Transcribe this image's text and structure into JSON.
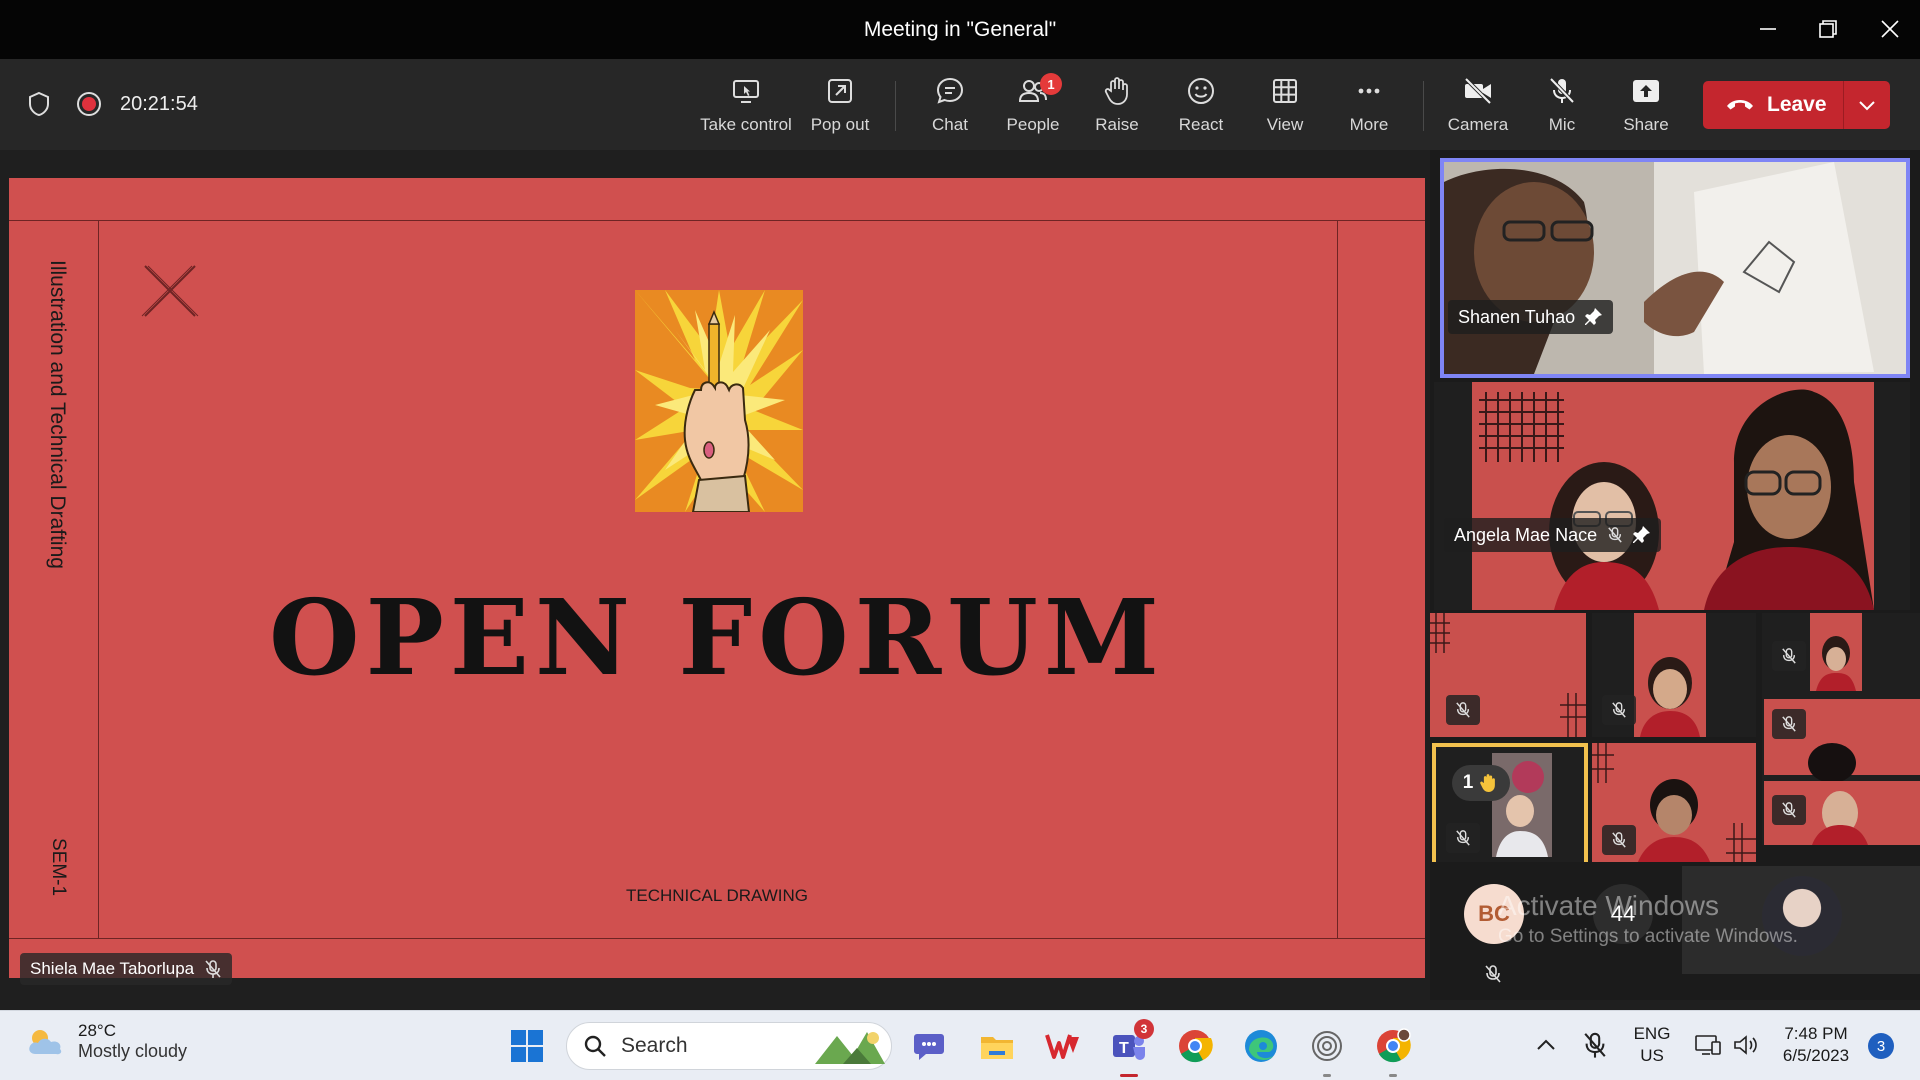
{
  "window": {
    "title": "Meeting in \"General\""
  },
  "toolbar": {
    "timer": "20:21:54",
    "buttons": {
      "take_control": "Take control",
      "pop_out": "Pop out",
      "chat": "Chat",
      "people": "People",
      "people_badge": "1",
      "raise": "Raise",
      "react": "React",
      "view": "View",
      "more": "More",
      "camera": "Camera",
      "mic": "Mic",
      "share": "Share"
    },
    "leave_label": "Leave"
  },
  "slide": {
    "side_text": "Illustration and Technical Drafting",
    "sem_text": "SEM-1",
    "title": "OPEN  FORUM",
    "subtitle": "TECHNICAL DRAWING",
    "background_color": "#d0504f"
  },
  "presenter": {
    "name": "Shiela Mae Taborlupa"
  },
  "participants": {
    "pinned": [
      {
        "name": "Shanen Tuhao"
      },
      {
        "name": "Angela Mae Nace"
      }
    ],
    "raised_hand_count": "1",
    "avatar_initials": "BC",
    "overflow_count": "44"
  },
  "watermark": {
    "line1": "Activate Windows",
    "line2": "Go to Settings to activate Windows."
  },
  "taskbar": {
    "weather_temp": "28°C",
    "weather_desc": "Mostly cloudy",
    "search_placeholder": "Search",
    "teams_badge": "3",
    "language_line1": "ENG",
    "language_line2": "US",
    "time": "7:48 PM",
    "date": "6/5/2023",
    "notification_count": "3"
  },
  "colors": {
    "accent": "#7f85f5",
    "leave": "#c4262e",
    "raised_hand_border": "#f2c14e"
  }
}
